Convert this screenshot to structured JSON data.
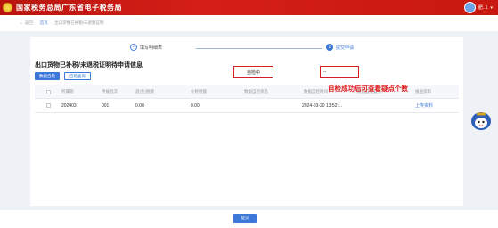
{
  "header": {
    "title": "国家税务总局广东省电子税务局",
    "username": "肥..1"
  },
  "breadcrumb": {
    "back": "← 返回",
    "home": "首页",
    "current": "出口货物已补税/未退税证明"
  },
  "steps": [
    {
      "label": "填写明细表"
    },
    {
      "number": "2",
      "label": "提交申请"
    }
  ],
  "page_title": "出口货物已补税/未退税证明待申请信息",
  "buttons": {
    "data_check": "数据自检",
    "self_check_query": "自检查询"
  },
  "table": {
    "columns": [
      "所属期",
      "申报批次",
      "退(免)税额",
      "补税税额",
      "数据自检状态",
      "数据自检时间",
      "数据自检疑点",
      "报送资料"
    ],
    "rows": [
      {
        "period": "202403",
        "batch": "001",
        "refund_amount": "0.00",
        "supplement_tax": "0.00",
        "check_status": "自检中",
        "check_time": "2024-03-20 13:52:...",
        "doubt_points": "--",
        "action": "上传资料"
      }
    ]
  },
  "annotation": "自检成功后可查看疑点个数",
  "submit_label": "提交"
}
